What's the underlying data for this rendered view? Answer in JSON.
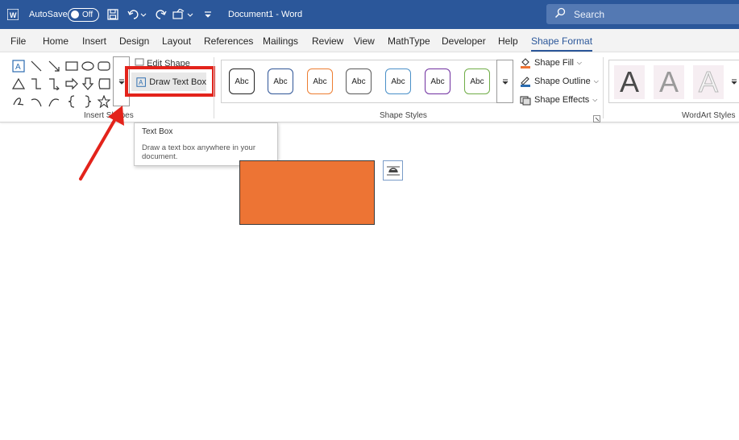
{
  "titlebar": {
    "autosave_label": "AutoSave",
    "autosave_state": "Off",
    "document_title": "Document1 - Word",
    "search_placeholder": "Search"
  },
  "menu": {
    "tabs": [
      "File",
      "Home",
      "Insert",
      "Design",
      "Layout",
      "References",
      "Mailings",
      "Review",
      "View",
      "MathType",
      "Developer",
      "Help",
      "Shape Format"
    ],
    "active_tab": "Shape Format"
  },
  "ribbon": {
    "insert_shapes": {
      "label": "Insert Shapes",
      "edit_shape_label": "Edit Shape",
      "draw_text_box_label": "Draw Text Box"
    },
    "shape_styles": {
      "label": "Shape Styles",
      "preset_text": "Abc",
      "preset_colors": [
        "#222222",
        "#2f5597",
        "#ed7d31",
        "#595959",
        "#4a90c8",
        "#7030a0",
        "#70ad47"
      ],
      "shape_fill_label": "Shape Fill",
      "shape_outline_label": "Shape Outline",
      "shape_effects_label": "Shape Effects"
    },
    "wordart_styles": {
      "label": "WordArt Styles",
      "letter": "A"
    }
  },
  "tooltip": {
    "title": "Text Box",
    "description": "Draw a text box anywhere in your document."
  },
  "colors": {
    "title_bar": "#2b579a",
    "shape_fill": "#ed7434",
    "highlight": "#e3231b"
  }
}
